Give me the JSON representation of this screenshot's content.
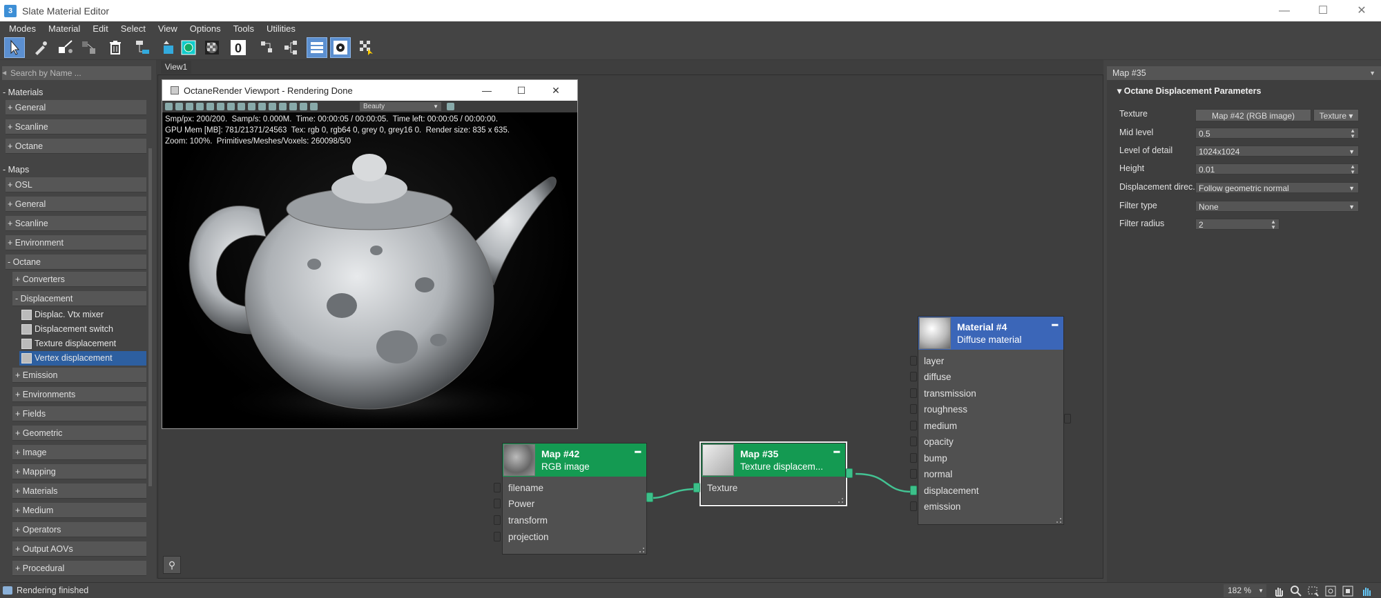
{
  "window": {
    "title": "Slate Material Editor",
    "app_icon": "3",
    "minimize": "—",
    "maximize": "☐",
    "close": "✕"
  },
  "menu": [
    "Modes",
    "Material",
    "Edit",
    "Select",
    "View",
    "Options",
    "Tools",
    "Utilities"
  ],
  "toolbar": {
    "icons": [
      "select-arrow-icon",
      "eyedropper-icon",
      "pick-material-icon",
      "move-children-icon",
      "delete-icon",
      "layout-all-icon",
      "layout-children-icon",
      "show-shaded-icon",
      "show-background-icon",
      "material-id-icon",
      "hide-unused-slots-icon",
      "layout-icon",
      "parameter-editor-icon",
      "navigator-icon",
      "render-map-icon"
    ],
    "material_id": "0"
  },
  "left_panel": {
    "search_placeholder": "Search by Name ...",
    "sections": {
      "materials": "- Materials",
      "materials_items": [
        "+ General",
        "+ Scanline",
        "+ Octane"
      ],
      "maps": "- Maps",
      "maps_items": [
        "+ OSL",
        "+ General",
        "+ Scanline",
        "+ Environment"
      ],
      "octane": "- Octane",
      "octane_items": [
        "+ Converters"
      ],
      "displacement": "- Displacement",
      "displacement_items": [
        "Displac. Vtx mixer",
        "Displacement switch",
        "Texture displacement",
        "Vertex displacement"
      ],
      "more_items": [
        "+ Emission",
        "+ Environments",
        "+ Fields",
        "+ Geometric",
        "+ Image",
        "+ Mapping",
        "+ Materials",
        "+ Medium",
        "+ Operators",
        "+ Output AOVs",
        "+ Procedural"
      ]
    }
  },
  "view": {
    "tab": "View1"
  },
  "octane_viewport": {
    "title": "OctaneRender Viewport - Rendering Done",
    "pass": "Beauty",
    "stats_line1": "Smp/px: 200/200.  Samp/s: 0.000M.  Time: 00:00:05 / 00:00:05.  Time left: 00:00:05 / 00:00:00.",
    "stats_line2": "GPU Mem [MB]: 781/21371/24563  Tex: rgb 0, rgb64 0, grey 0, grey16 0.  Render size: 835 x 635.",
    "stats_line3": "Zoom: 100%.  Primitives/Meshes/Voxels: 260098/5/0"
  },
  "nodes": {
    "map42": {
      "title": "Map #42",
      "subtitle": "RGB image",
      "slots": [
        "filename",
        "Power",
        "transform",
        "projection"
      ]
    },
    "map35": {
      "title": "Map #35",
      "subtitle": "Texture displacem...",
      "slots": [
        "Texture"
      ]
    },
    "material4": {
      "title": "Material #4",
      "subtitle": "Diffuse material",
      "slots": [
        "layer",
        "diffuse",
        "transmission",
        "roughness",
        "medium",
        "opacity",
        "bump",
        "normal",
        "displacement",
        "emission"
      ]
    }
  },
  "right_panel": {
    "header": "Map #35",
    "rollout": "Octane Displacement Parameters",
    "params": {
      "texture_label": "Texture",
      "texture_value": "Map #42 (RGB image)",
      "texture_type": "Texture",
      "mid_label": "Mid level",
      "mid_value": "0.5",
      "lod_label": "Level of detail",
      "lod_value": "1024x1024",
      "height_label": "Height",
      "height_value": "0.01",
      "dir_label": "Displacement direc...",
      "dir_value": "Follow geometric normal",
      "filter_label": "Filter type",
      "filter_value": "None",
      "radius_label": "Filter radius",
      "radius_value": "2"
    }
  },
  "status": {
    "text": "Rendering finished",
    "zoom": "182 %"
  },
  "colors": {
    "green_header": "#149a52",
    "blue_header": "#3b66b8",
    "socket_on": "#3cc08a",
    "selected": "#2d5fa0"
  }
}
